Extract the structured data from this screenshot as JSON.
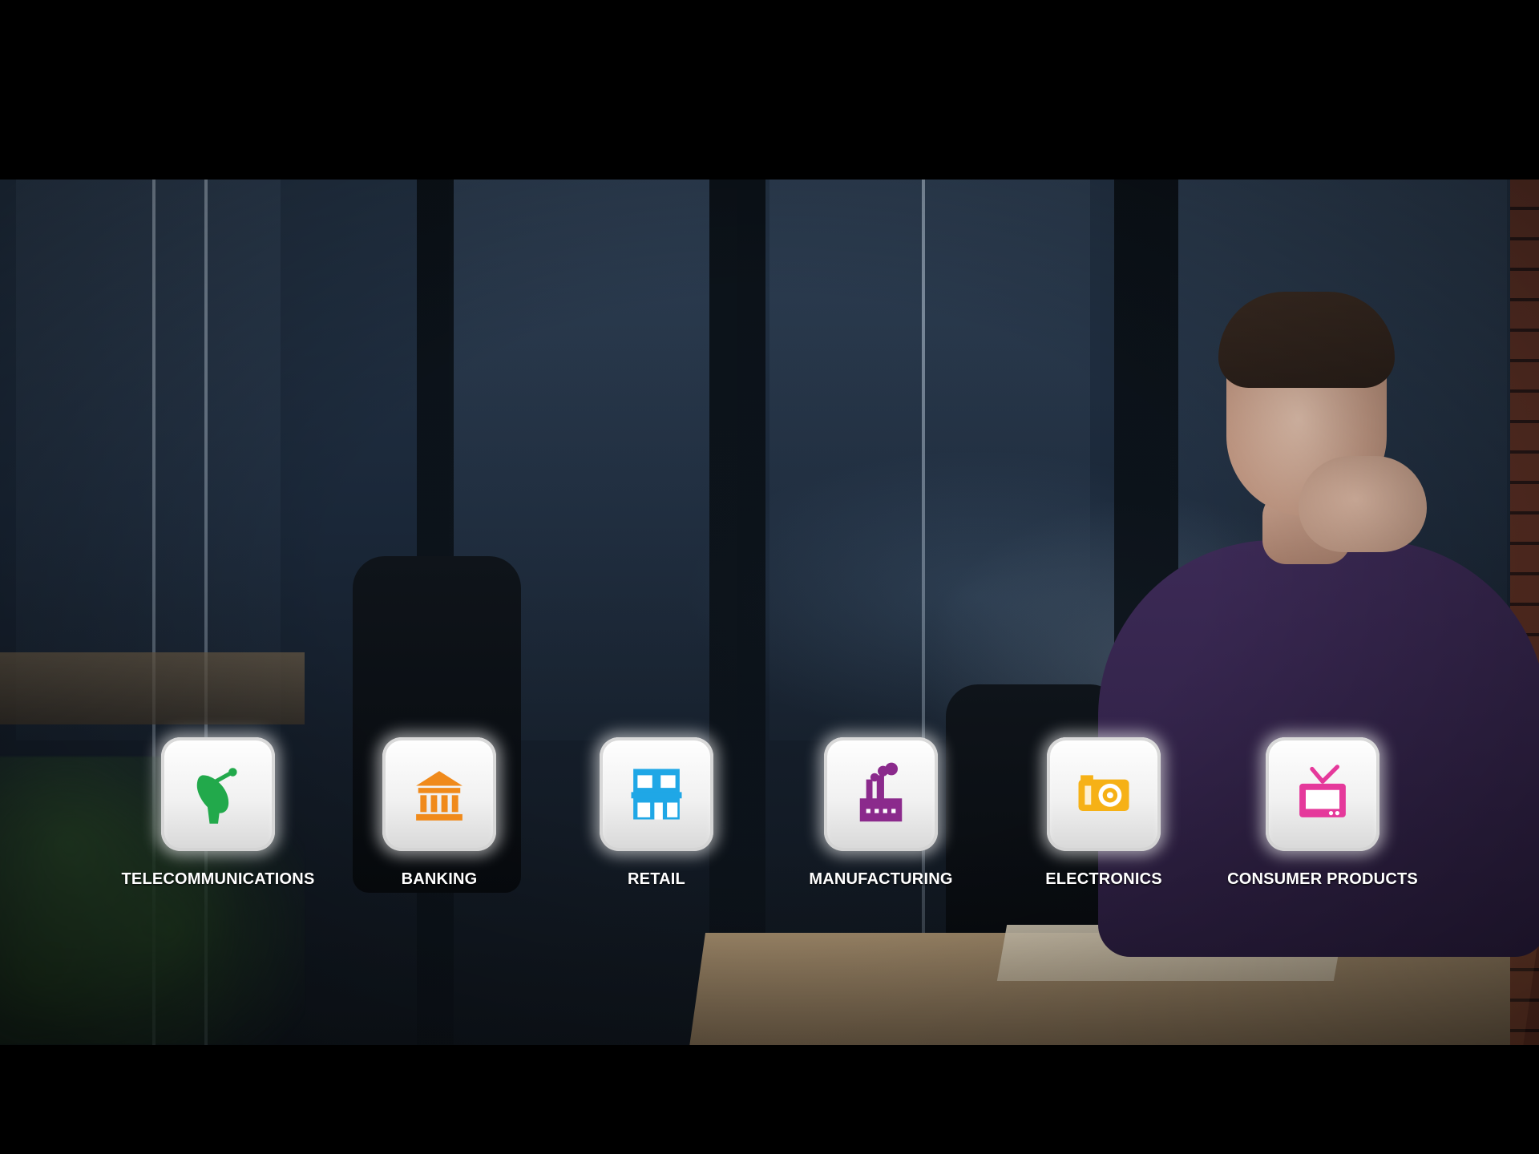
{
  "colors": {
    "letterbox": "#000000",
    "label_text": "#FFFFFF",
    "telecommunications_icon": "#22A94B",
    "banking_icon": "#F08A1B",
    "retail_icon": "#1FA7E6",
    "manufacturing_icon": "#8B2A8C",
    "electronics_icon": "#F6B116",
    "consumer_products_icon": "#E5399B"
  },
  "categories": [
    {
      "label": "TELECOMMUNICATIONS",
      "icon": "satellite-dish-icon"
    },
    {
      "label": "BANKING",
      "icon": "bank-icon"
    },
    {
      "label": "RETAIL",
      "icon": "storefront-icon"
    },
    {
      "label": "MANUFACTURING",
      "icon": "factory-icon"
    },
    {
      "label": "ELECTRONICS",
      "icon": "camera-icon"
    },
    {
      "label": "CONSUMER PRODUCTS",
      "icon": "television-icon"
    }
  ]
}
